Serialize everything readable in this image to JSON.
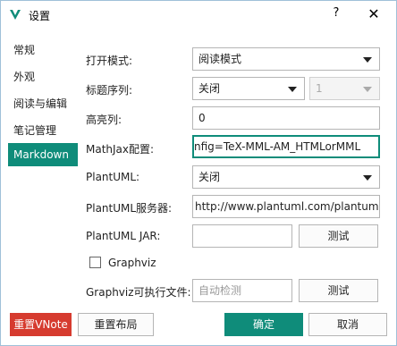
{
  "window": {
    "title": "设置",
    "help_label": "?",
    "close_label": "✕",
    "accent_color": "#0f8c7a",
    "danger_color": "#d63b2f"
  },
  "sidebar": {
    "items": [
      {
        "label": "常规"
      },
      {
        "label": "外观"
      },
      {
        "label": "阅读与编辑"
      },
      {
        "label": "笔记管理"
      },
      {
        "label": "Markdown",
        "selected": true
      }
    ]
  },
  "form": {
    "open_mode": {
      "label": "打开模式:",
      "value": "阅读模式"
    },
    "heading_seq": {
      "label": "标题序列:",
      "value": "关闭",
      "level_value": "1"
    },
    "highlight_col": {
      "label": "高亮列:",
      "value": "0"
    },
    "mathjax": {
      "label": "MathJax配置:",
      "value": "nfig=TeX-MML-AM_HTMLorMML"
    },
    "plantuml": {
      "label": "PlantUML:",
      "value": "关闭"
    },
    "plantuml_server": {
      "label": "PlantUML服务器:",
      "value": "http://www.plantuml.com/plantuml"
    },
    "plantuml_jar": {
      "label": "PlantUML JAR:",
      "value": "",
      "test_label": "测试"
    },
    "graphviz": {
      "label": "Graphviz",
      "checked": false
    },
    "graphviz_exec": {
      "label": "Graphviz可执行文件:",
      "placeholder": "自动检测",
      "test_label": "测试"
    }
  },
  "footer": {
    "reset_vnote": "重置VNote",
    "reset_layout": "重置布局",
    "ok": "确定",
    "cancel": "取消"
  }
}
